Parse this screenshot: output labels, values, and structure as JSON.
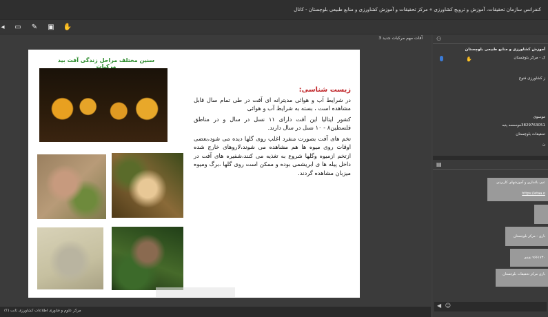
{
  "window": {
    "title": "کنفرانس سازمان تحقیقات، آموزش و ترویج کشاورزی » مرکز تحقیقات و آموزش کشاورزی و منابع طبیعی بلوچستان - کانال"
  },
  "toolbar": {
    "icons": [
      "share-icon",
      "screen-icon",
      "pen-icon",
      "play-icon",
      "hand-icon"
    ]
  },
  "stage": {
    "bar_label": "آفات مهم مرکبات جدید 3"
  },
  "slide": {
    "title": "سنین مختلف مراحل زندگی آفت بید مرکبات",
    "heading": "زیست شناسی:",
    "p1": "در شرایط آب و هوائی مدیترانه ای آفت در طی تمام سال قابل مشاهده است ، بسته به شرایط آب و هوائی",
    "p2": "کشور ایتالیا این آفت دارای ۱۱ نسل در سال و در مناطق فلسطین۸ - ۱۰ نسل در سال دارند.",
    "p3": "تخم های آفت بصورت منفرد اغلب روی گلها دیده می شود،بعضی اوقات روی میوه ها هم مشاهده می شوند،لاروهای خارج شده ازتخم ازمیوه وگلها شروع به تغذیه می کنند،شفیره های آفت در داخل پیله ها ی ابریشمی بوده و ممکن است روی گلها ،برگ ومیوه میزبان مشاهده گردند."
  },
  "status": {
    "text": "مرکز علوم و فناوری اطلاعات کشاورزی ثانت (؟)"
  },
  "users": {
    "org": "آموزش کشاورزی و منابع طبیعی بلوچستان",
    "u1": "ک - مرکز بلوچستان",
    "u2": "ز کشاورزی فنوج",
    "u3": "موسوی",
    "u4": "3829763051موسسه پنبه",
    "u5": "تحقیقات بلوچستان",
    "u6": "ن"
  },
  "chat": {
    "m1": "عیی باغداری و آموزشهای کاربردی",
    "m1b": "https://etaa.o",
    "m2": "",
    "m3": "باری - مرکز بلوچستان",
    "m4": "۹۶۶۱۷۳۰ نقدی",
    "m5": "بازی مرکز تحقیقات بلوچستان"
  },
  "colors": {
    "title_green": "#2a8a2a",
    "heading_red": "#c0262a",
    "mic_blue": "#3b7bd6"
  }
}
